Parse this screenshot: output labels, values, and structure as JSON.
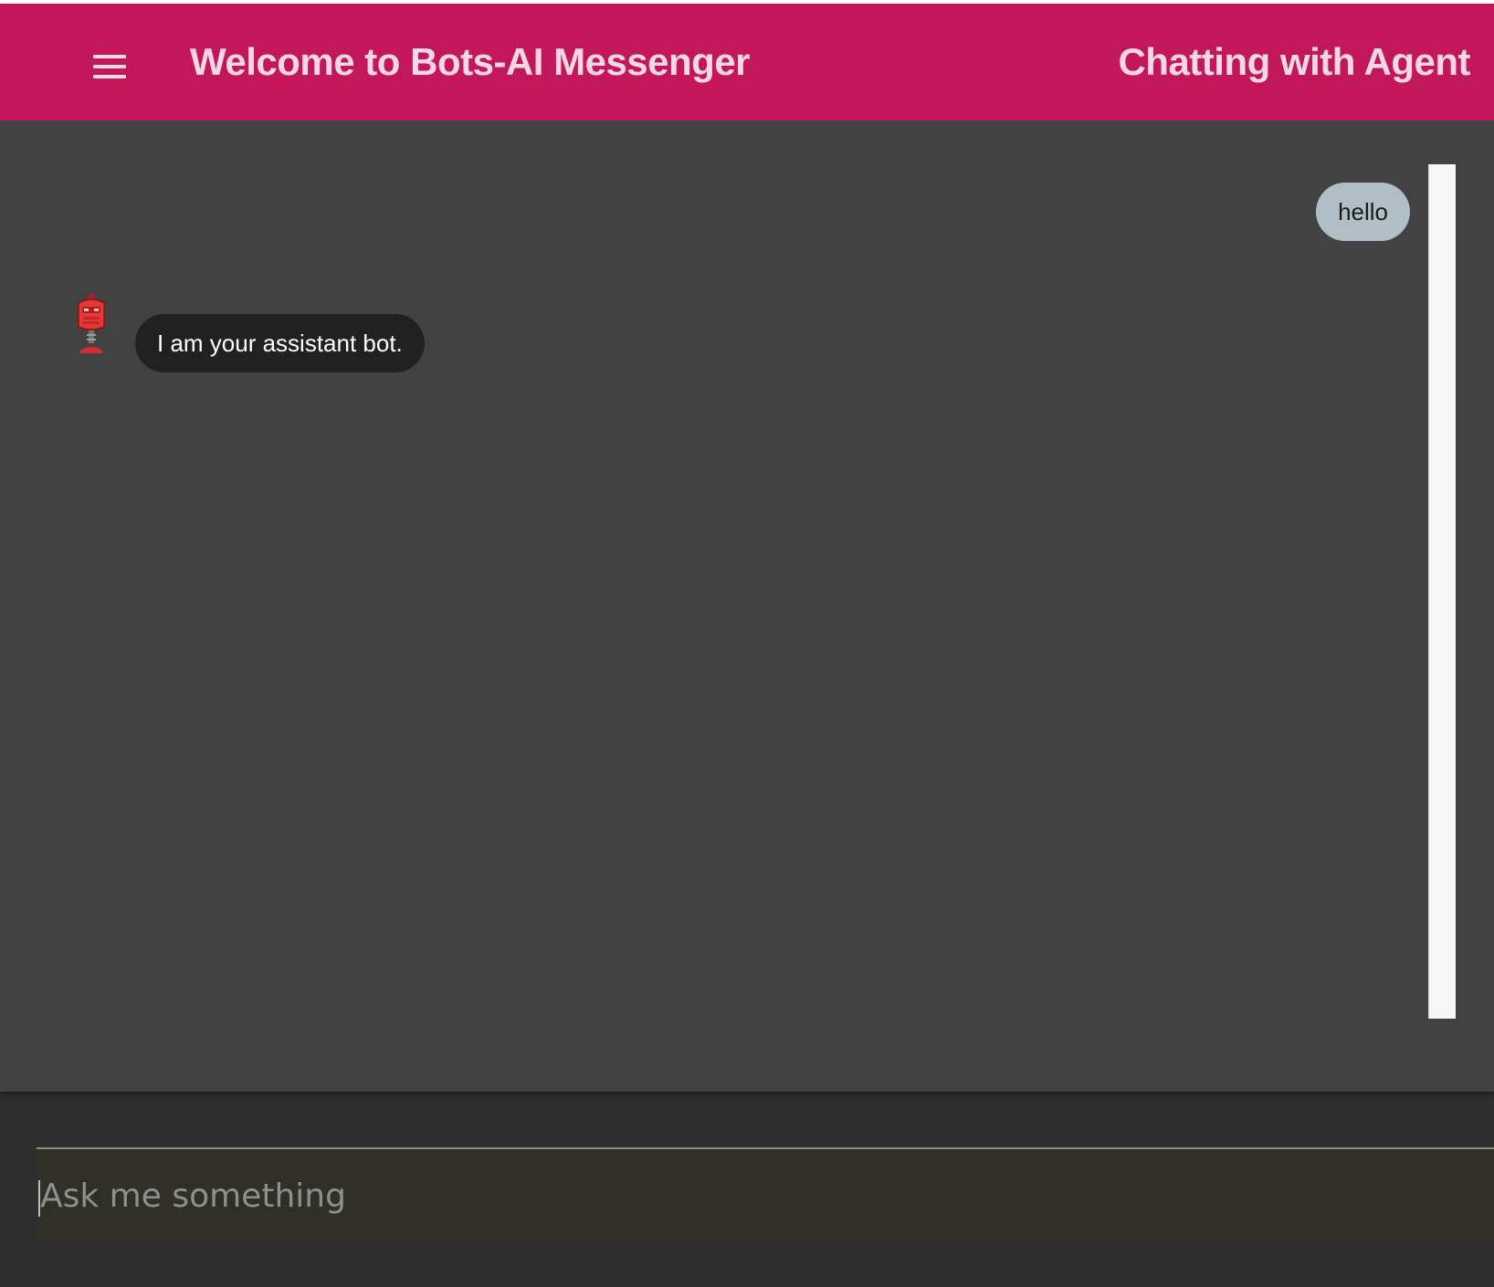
{
  "header": {
    "title": "Welcome to Bots-AI Messenger",
    "status": "Chatting with Agent",
    "menu_icon": "hamburger-menu-icon"
  },
  "messages": [
    {
      "sender": "user",
      "text": "hello"
    },
    {
      "sender": "bot",
      "text": "I am your assistant bot.",
      "avatar_icon": "robot-icon"
    }
  ],
  "composer": {
    "placeholder": "Ask me something",
    "value": ""
  },
  "colors": {
    "app_bar": "#c2185b",
    "header_text": "#f8d7e4",
    "chat_background": "#424242",
    "user_bubble": "#b0bec5",
    "bot_bubble": "#212121",
    "input_background": "#303029"
  }
}
